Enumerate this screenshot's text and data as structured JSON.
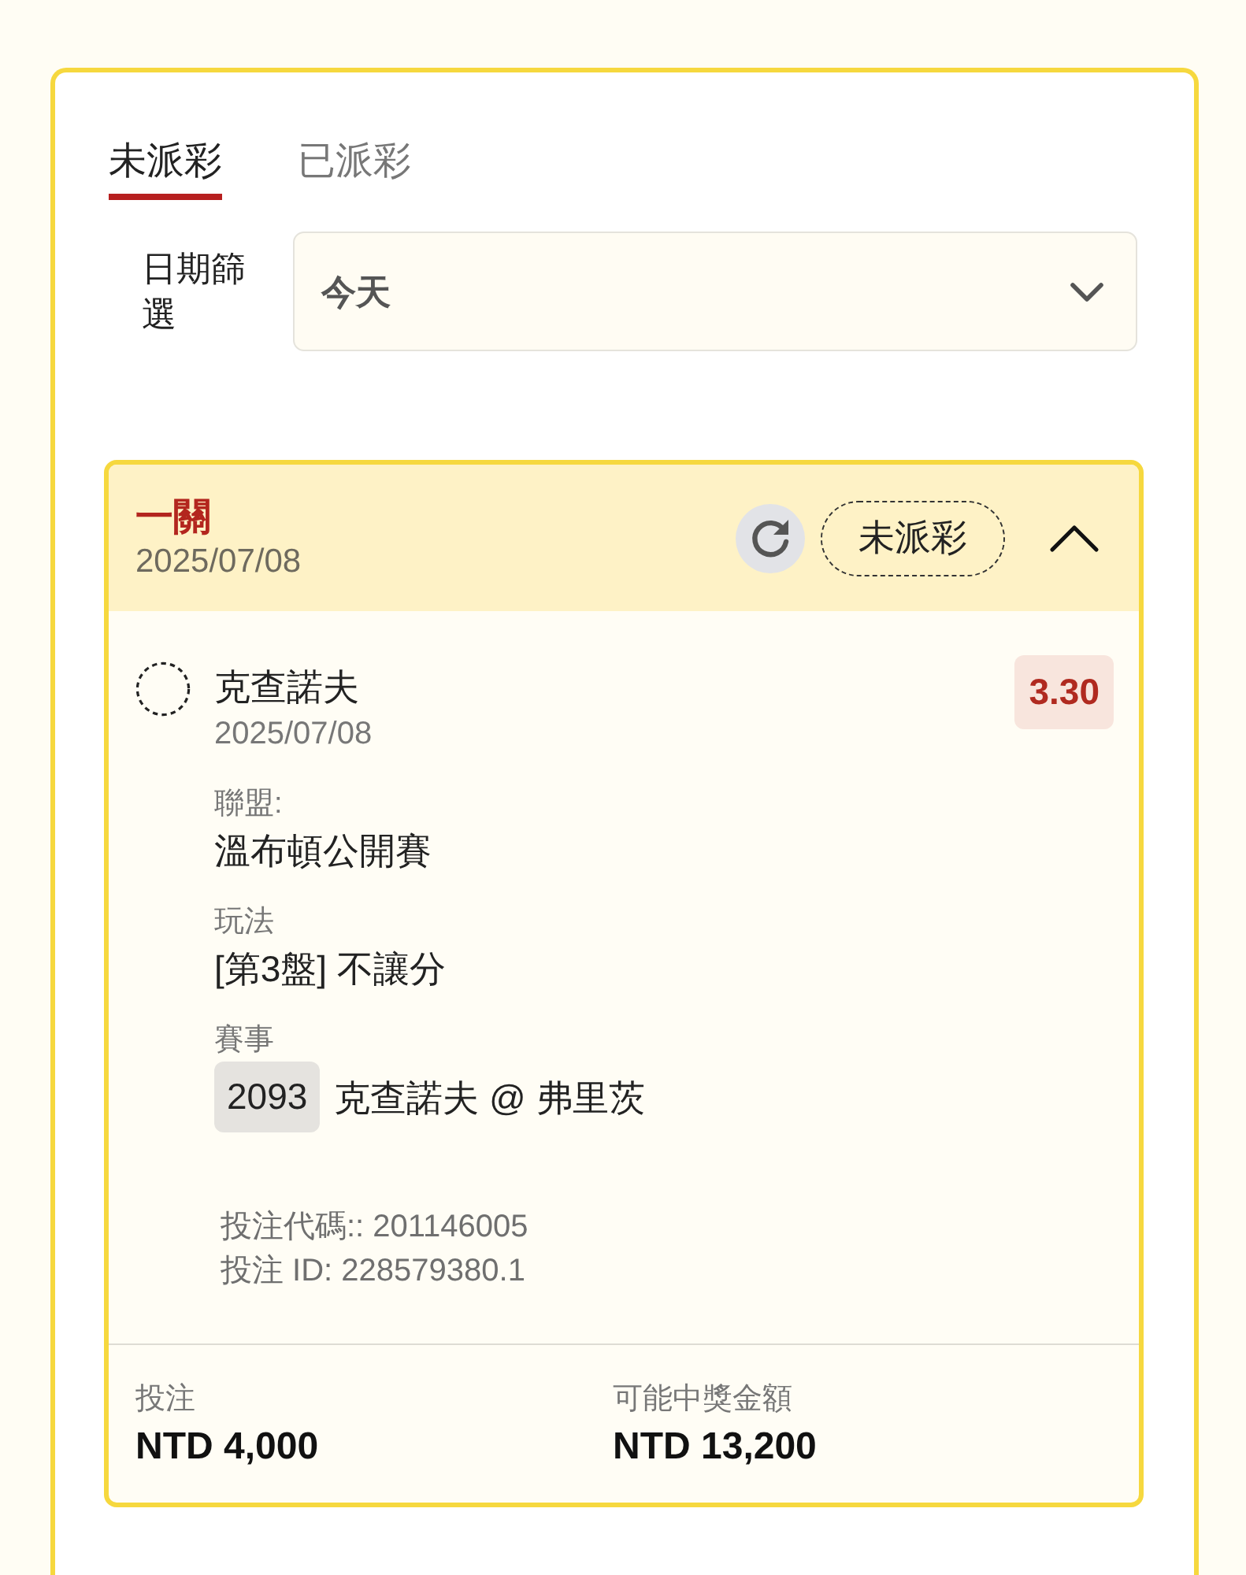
{
  "tabs": [
    {
      "label": "未派彩",
      "selected": true
    },
    {
      "label": "已派彩",
      "selected": false
    }
  ],
  "date_filter": {
    "label": "日期篩選",
    "value": "今天"
  },
  "bets": [
    {
      "type": "一關",
      "date": "2025/07/08",
      "status": "未派彩",
      "expanded": true,
      "selections": [
        {
          "name": "克查諾夫",
          "date": "2025/07/08",
          "odds": "3.30",
          "fields": [
            {
              "label": "聯盟:",
              "value": "溫布頓公開賽"
            },
            {
              "label": "玩法",
              "value": "[第3盤] 不讓分"
            },
            {
              "label": "賽事",
              "event_number": "2093",
              "value": "克查諾夫 @ 弗里茨"
            }
          ]
        }
      ],
      "bet_code": "投注代碼:: 201146005",
      "bet_id": "投注 ID: 228579380.1",
      "stake_label": "投注",
      "stake": "NTD 4,000",
      "payout_label": "可能中獎金額",
      "payout": "NTD 13,200"
    }
  ]
}
